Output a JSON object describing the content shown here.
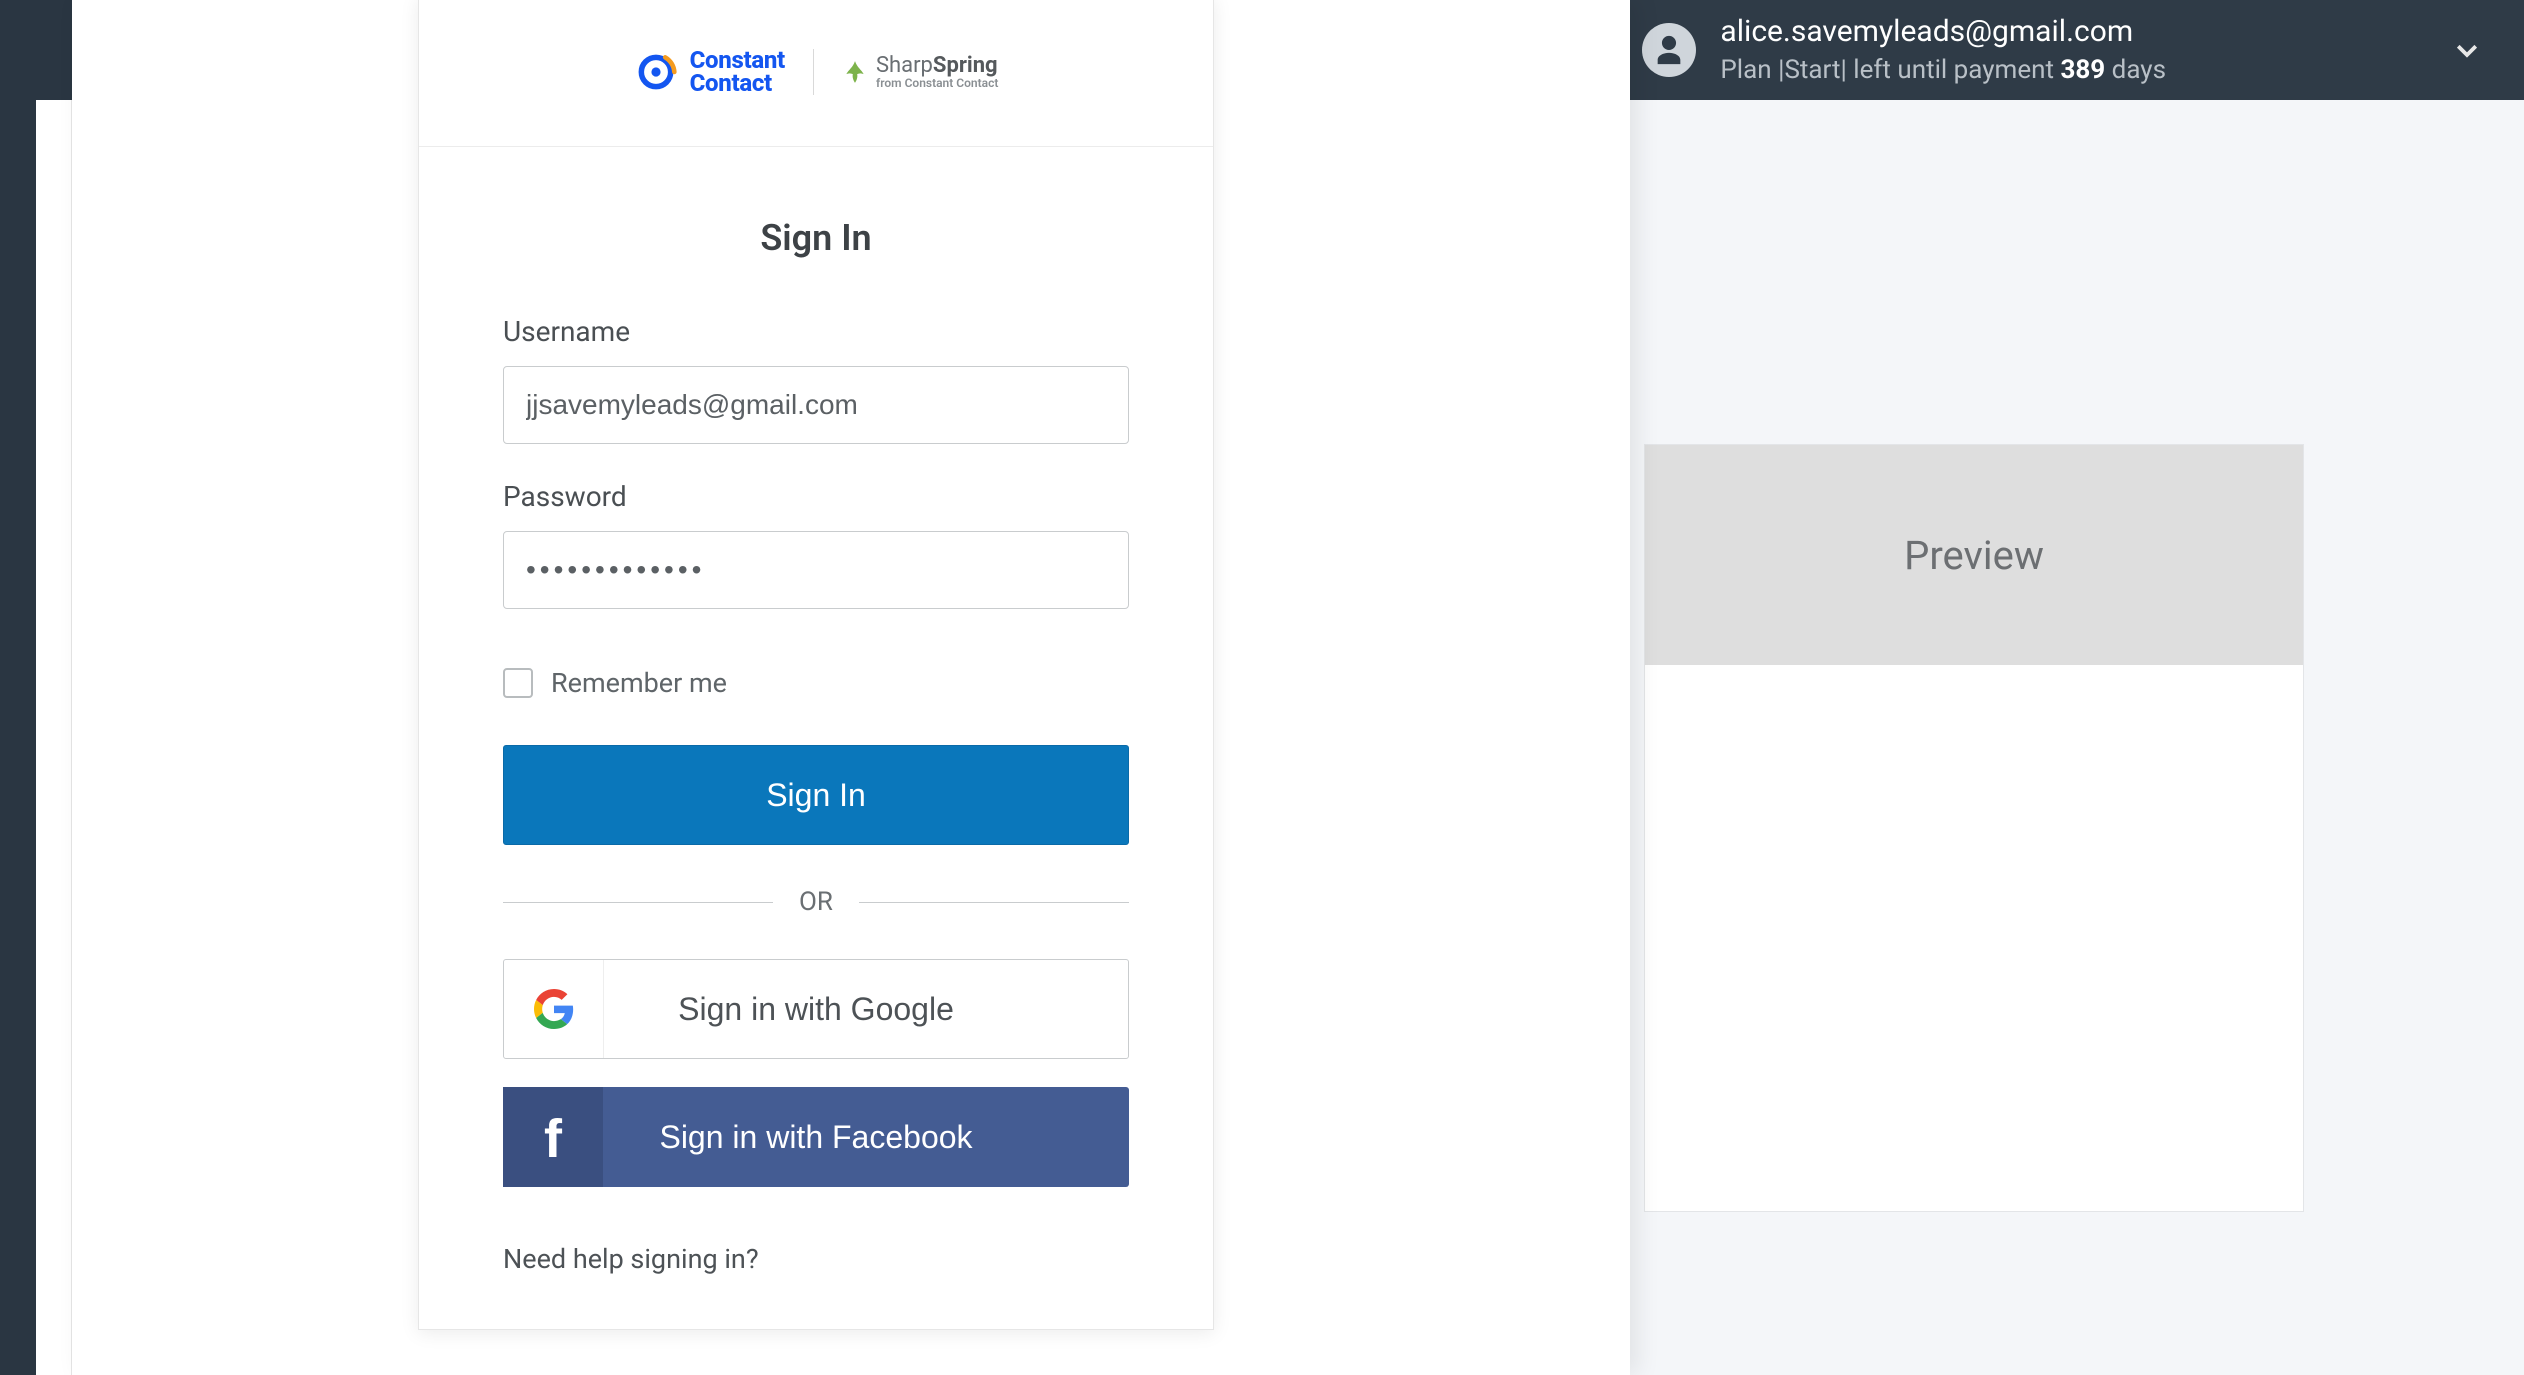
{
  "header": {
    "account_email": "alice.savemyleads@gmail.com",
    "plan_prefix": "Plan ",
    "plan_name": "|Start|",
    "plan_mid": " left until payment ",
    "plan_days_num": "389",
    "plan_days_suffix": " days"
  },
  "preview": {
    "title": "Preview"
  },
  "logos": {
    "constant_line1": "Constant",
    "constant_line2": "Contact",
    "sharpspring_line1_a": "Sharp",
    "sharpspring_line1_b": "Spring",
    "sharpspring_line2": "from Constant Contact"
  },
  "signin": {
    "title": "Sign In",
    "username_label": "Username",
    "username_value": "jjsavemyleads@gmail.com",
    "password_label": "Password",
    "password_value": "•••••••••••••",
    "remember_label": "Remember me",
    "submit_label": "Sign In",
    "or_label": "OR",
    "google_label": "Sign in with Google",
    "facebook_label": "Sign in with Facebook",
    "help_label": "Need help signing in?"
  }
}
